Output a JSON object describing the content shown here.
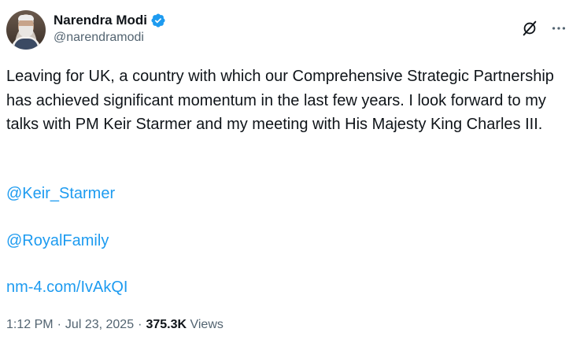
{
  "author": {
    "display_name": "Narendra Modi",
    "handle": "@narendramodi",
    "verified": true,
    "verified_color": "#1d9bf0"
  },
  "tweet": {
    "text": "Leaving for UK, a country with which our Comprehensive Strategic Partnership has achieved significant momentum in the last few years. I look forward to my talks with PM Keir Starmer and my meeting with His Majesty King Charles III.",
    "mentions": [
      "@Keir_Starmer",
      "@RoyalFamily"
    ],
    "link": "nm-4.com/IvAkQI",
    "link_color": "#1d9bf0"
  },
  "meta": {
    "time": "1:12 PM",
    "date": "Jul 23, 2025",
    "dot": "·",
    "views_count": "375.3K",
    "views_label": "Views"
  },
  "icons": {
    "grok": "grok-icon",
    "more": "more-icon",
    "verified": "verified-badge-icon"
  }
}
